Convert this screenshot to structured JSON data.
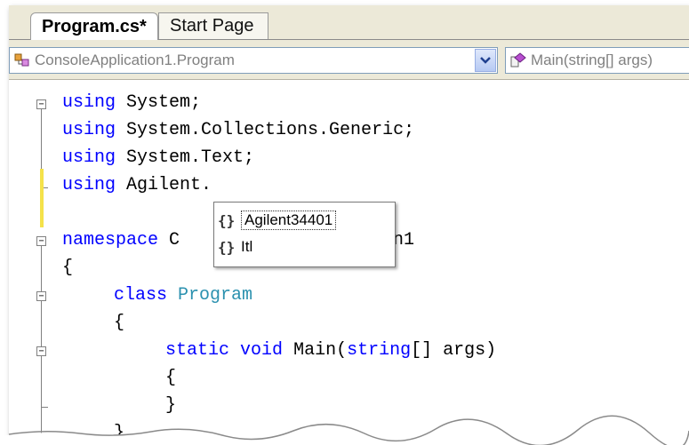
{
  "tabs": [
    {
      "label": "Program.cs*",
      "active": true
    },
    {
      "label": "Start Page",
      "active": false
    }
  ],
  "navbar": {
    "type_combo": {
      "value": "ConsoleApplication1.Program",
      "icon": "class-icon"
    },
    "member_combo": {
      "value": "Main(string[] args)",
      "icon": "method-icon"
    }
  },
  "code": {
    "line1": {
      "kw": "using",
      "rest": " System;"
    },
    "line2": {
      "kw": "using",
      "rest": " System.Collections.Generic;"
    },
    "line3": {
      "kw": "using",
      "rest": " System.Text;"
    },
    "line4": {
      "kw": "using",
      "rest": " Agilent."
    },
    "line6": {
      "kw": "namespace",
      "rest_a": " C",
      "rest_b": "ion1"
    },
    "line7": "{",
    "line8": {
      "kw": "class",
      "type": "Program"
    },
    "line9": "{",
    "line10": {
      "kw1": "static",
      "kw2": "void",
      "name": "Main(",
      "kw3": "string",
      "rest": "[] args)"
    },
    "line11": "{",
    "line12": "}",
    "line13": "}"
  },
  "intellisense": {
    "items": [
      {
        "icon": "{}",
        "label": "Agilent34401",
        "selected": true
      },
      {
        "icon": "{}",
        "label": "Itl",
        "selected": false
      }
    ]
  },
  "colors": {
    "keyword": "#0000ff",
    "type": "#2b91af",
    "chrome": "#ece9d8",
    "changed_line_marker": "#f5e24a"
  }
}
